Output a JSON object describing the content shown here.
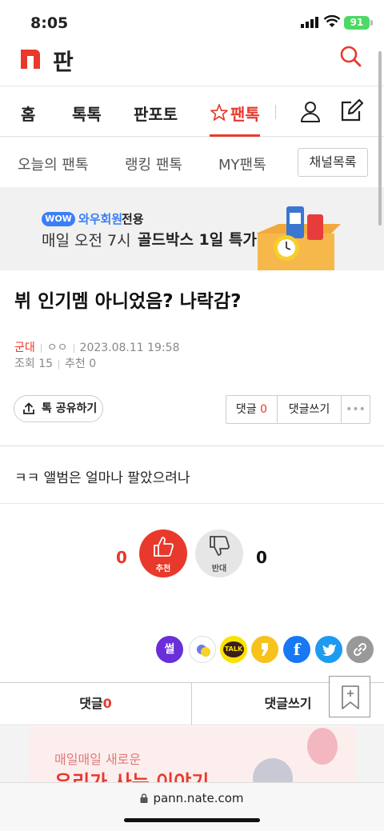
{
  "status_bar": {
    "time": "8:05",
    "battery": "91"
  },
  "header": {
    "logo_text": "판"
  },
  "main_nav": {
    "tabs": [
      "홈",
      "톡톡",
      "판포토",
      "팬톡"
    ],
    "active": "팬톡"
  },
  "sub_nav": {
    "items": [
      "오늘의 팬톡",
      "랭킹 팬톡",
      "MY팬톡"
    ],
    "channel_button": "채널목록"
  },
  "banner": {
    "badge": "WOW",
    "member": "와우회원",
    "member_only": "전용",
    "line_a": "매일 오전 7시",
    "line_b": "골드박스 1일 특가"
  },
  "post": {
    "title": "뷔 인기멤 아니었음? 나락감?",
    "category": "군대",
    "author": "ㅇㅇ",
    "date": "2023.08.11 19:58",
    "views_label": "조회",
    "views": "15",
    "recommend_label": "추천",
    "recommend": "0",
    "body": "ㅋㅋ 앨범은 얼마나 팔았으려나"
  },
  "actions": {
    "share": "톡 공유하기",
    "comment_label": "댓글",
    "comment_count": "0",
    "write_comment": "댓글쓰기",
    "more": "•••"
  },
  "vote": {
    "up_count": "0",
    "up_label": "추천",
    "down_count": "0",
    "down_label": "반대"
  },
  "sns": [
    {
      "name": "ssul",
      "label": "썰",
      "color": "#6a2fd8"
    },
    {
      "name": "band",
      "label": "",
      "color": "#ffffff"
    },
    {
      "name": "kakaotalk",
      "label": "TALK",
      "color": "#fae100"
    },
    {
      "name": "kakaostory",
      "label": "",
      "color": "#f7c21b"
    },
    {
      "name": "facebook",
      "label": "f",
      "color": "#1877f2"
    },
    {
      "name": "twitter",
      "label": "",
      "color": "#1d9bf0"
    },
    {
      "name": "link",
      "label": "",
      "color": "#999999"
    }
  ],
  "bottom_bar": {
    "comment_label": "댓글",
    "comment_count": "0",
    "write_comment": "댓글쓰기"
  },
  "ad": {
    "line1": "매일매일 새로운",
    "line2": "우리가 사는 이야기"
  },
  "browser": {
    "url": "pann.nate.com"
  },
  "colors": {
    "accent": "#e8392c",
    "wow": "#3a7ff6"
  }
}
